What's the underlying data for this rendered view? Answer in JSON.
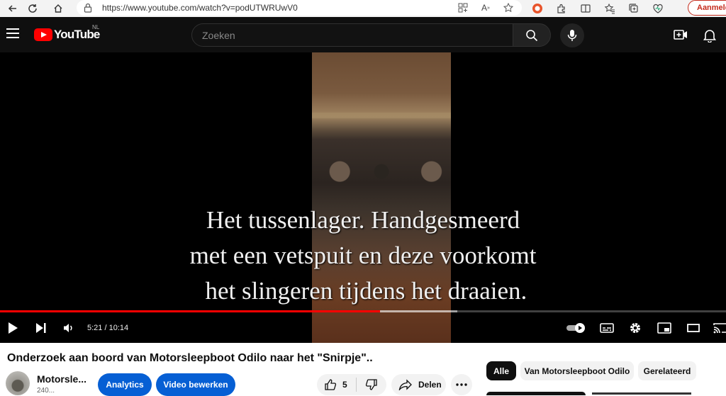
{
  "browser": {
    "url": "https://www.youtube.com/watch?v=podUTWRUwV0",
    "signin_label": "Aanmeld"
  },
  "header": {
    "logo_text": "YouTube",
    "country_code": "NL",
    "search_placeholder": "Zoeken"
  },
  "video": {
    "subtitle_lines": [
      "Het tussenlager. Handgesmeerd",
      "met een vetspuit en deze voorkomt",
      " het slingeren tijdens het draaien."
    ],
    "current_time": "5:21",
    "duration": "10:14",
    "time_display": "5:21 / 10:14",
    "played_fraction": 0.523,
    "buffered_fraction": 0.63,
    "progress_color": "#ff0000"
  },
  "info": {
    "title": "Onderzoek aan boord van Motorsleepboot Odilo naar het \"Snirpje\"..",
    "channel_name": "Motorsle...",
    "subscribers": "240...",
    "analytics_label": "Analytics",
    "edit_label": "Video bewerken",
    "likes": "5",
    "share_label": "Delen",
    "accent_color": "#065fd4"
  },
  "chips": [
    "Alle",
    "Van Motorsleepboot Odilo",
    "Gerelateerd"
  ]
}
